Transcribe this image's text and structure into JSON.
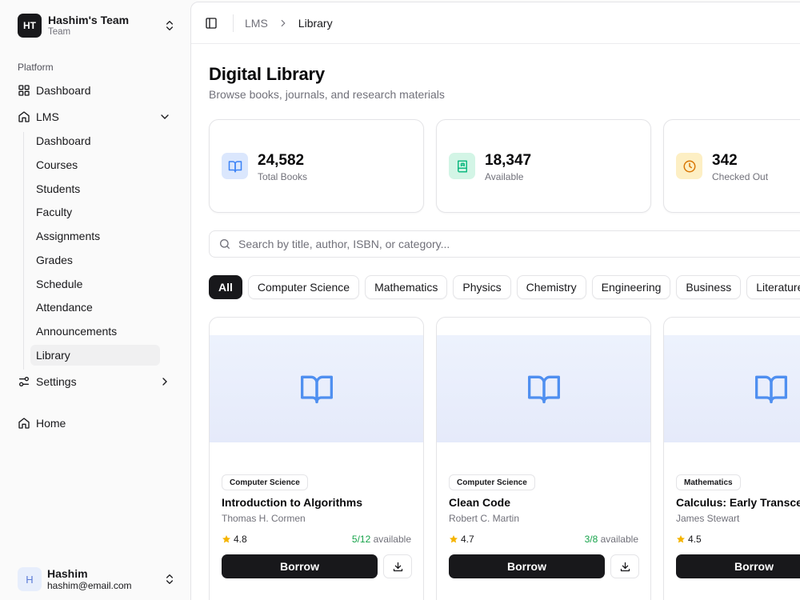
{
  "team": {
    "initials": "HT",
    "name": "Hashim's Team",
    "subtitle": "Team"
  },
  "sidebar": {
    "group_label": "Platform",
    "dashboard": "Dashboard",
    "lms": "LMS",
    "lms_items": [
      "Dashboard",
      "Courses",
      "Students",
      "Faculty",
      "Assignments",
      "Grades",
      "Schedule",
      "Attendance",
      "Announcements",
      "Library"
    ],
    "active_item": "Library",
    "settings": "Settings",
    "home": "Home"
  },
  "user": {
    "initial": "H",
    "name": "Hashim",
    "email": "hashim@email.com"
  },
  "breadcrumb": {
    "parent": "LMS",
    "current": "Library"
  },
  "page": {
    "title": "Digital Library",
    "subtitle": "Browse books, journals, and research materials"
  },
  "stats": [
    {
      "value": "24,582",
      "label": "Total Books",
      "icon": "book-open-icon",
      "color": "#3b82f6",
      "bg": "#dbe7fd"
    },
    {
      "value": "18,347",
      "label": "Available",
      "icon": "book-icon",
      "color": "#10b981",
      "bg": "#d3f5e6"
    },
    {
      "value": "342",
      "label": "Checked Out",
      "icon": "clock-icon",
      "color": "#d97706",
      "bg": "#fdefc4"
    }
  ],
  "search": {
    "placeholder": "Search by title, author, ISBN, or category..."
  },
  "categories": [
    "All",
    "Computer Science",
    "Mathematics",
    "Physics",
    "Chemistry",
    "Engineering",
    "Business",
    "Literature"
  ],
  "active_category": "All",
  "books": [
    {
      "category": "Computer Science",
      "title": "Introduction to Algorithms",
      "author": "Thomas H. Cormen",
      "rating": "4.8",
      "available": "5/12",
      "available_suffix": "available",
      "borrow_label": "Borrow"
    },
    {
      "category": "Computer Science",
      "title": "Clean Code",
      "author": "Robert C. Martin",
      "rating": "4.7",
      "available": "3/8",
      "available_suffix": "available",
      "borrow_label": "Borrow"
    },
    {
      "category": "Mathematics",
      "title": "Calculus: Early Transcen",
      "author": "James Stewart",
      "rating": "4.5",
      "available": "",
      "available_suffix": "",
      "borrow_label": "Borrow"
    }
  ],
  "colors": {
    "accent": "#18181b",
    "available_green": "#16a34a",
    "star": "#f5b400",
    "cover_icon": "#4f8ff0"
  }
}
